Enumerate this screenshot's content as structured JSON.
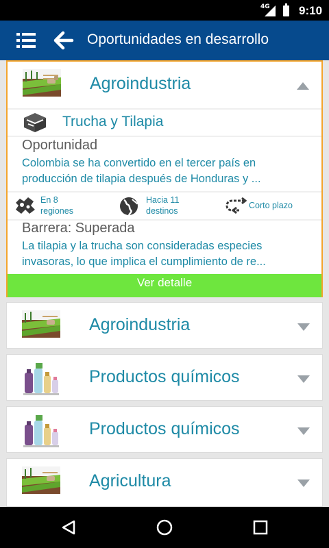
{
  "status_bar": {
    "network": "4G",
    "time": "9:10"
  },
  "app_bar": {
    "title": "Oportunidades en desarrollo",
    "menu_icon": "menu-icon",
    "back_icon": "back-arrow-icon"
  },
  "expanded_card": {
    "category": "Agroindustria",
    "subcategory": "Trucha y Tilapia",
    "opportunity_title": "Oportunidad",
    "opportunity_lines": [
      "Colombia se ha convertido en el tercer país en",
      "producción de tilapia después de Honduras y ..."
    ],
    "stats": {
      "regions_line1": "En 8",
      "regions_line2": "regiones",
      "destinations_line1": "Hacia 11",
      "destinations_line2": "destinos",
      "term": "Corto plazo"
    },
    "barrier_title": "Barrera: Superada",
    "barrier_lines": [
      "La tilapia y la trucha son consideradas especies",
      "invasoras, lo que implica el cumplimiento de re..."
    ],
    "detail_button": "Ver detalle"
  },
  "collapsed_cards": [
    {
      "label": "Agroindustria",
      "icon": "farm-icon"
    },
    {
      "label": "Productos químicos",
      "icon": "chemicals-icon"
    },
    {
      "label": "Productos químicos",
      "icon": "chemicals-icon"
    },
    {
      "label": "Agricultura",
      "icon": "farm-icon"
    }
  ],
  "colors": {
    "app_bar": "#064a8d",
    "accent_text": "#1e8aa6",
    "detail_button": "#6ee63e",
    "selected_border": "#f3a42c"
  }
}
